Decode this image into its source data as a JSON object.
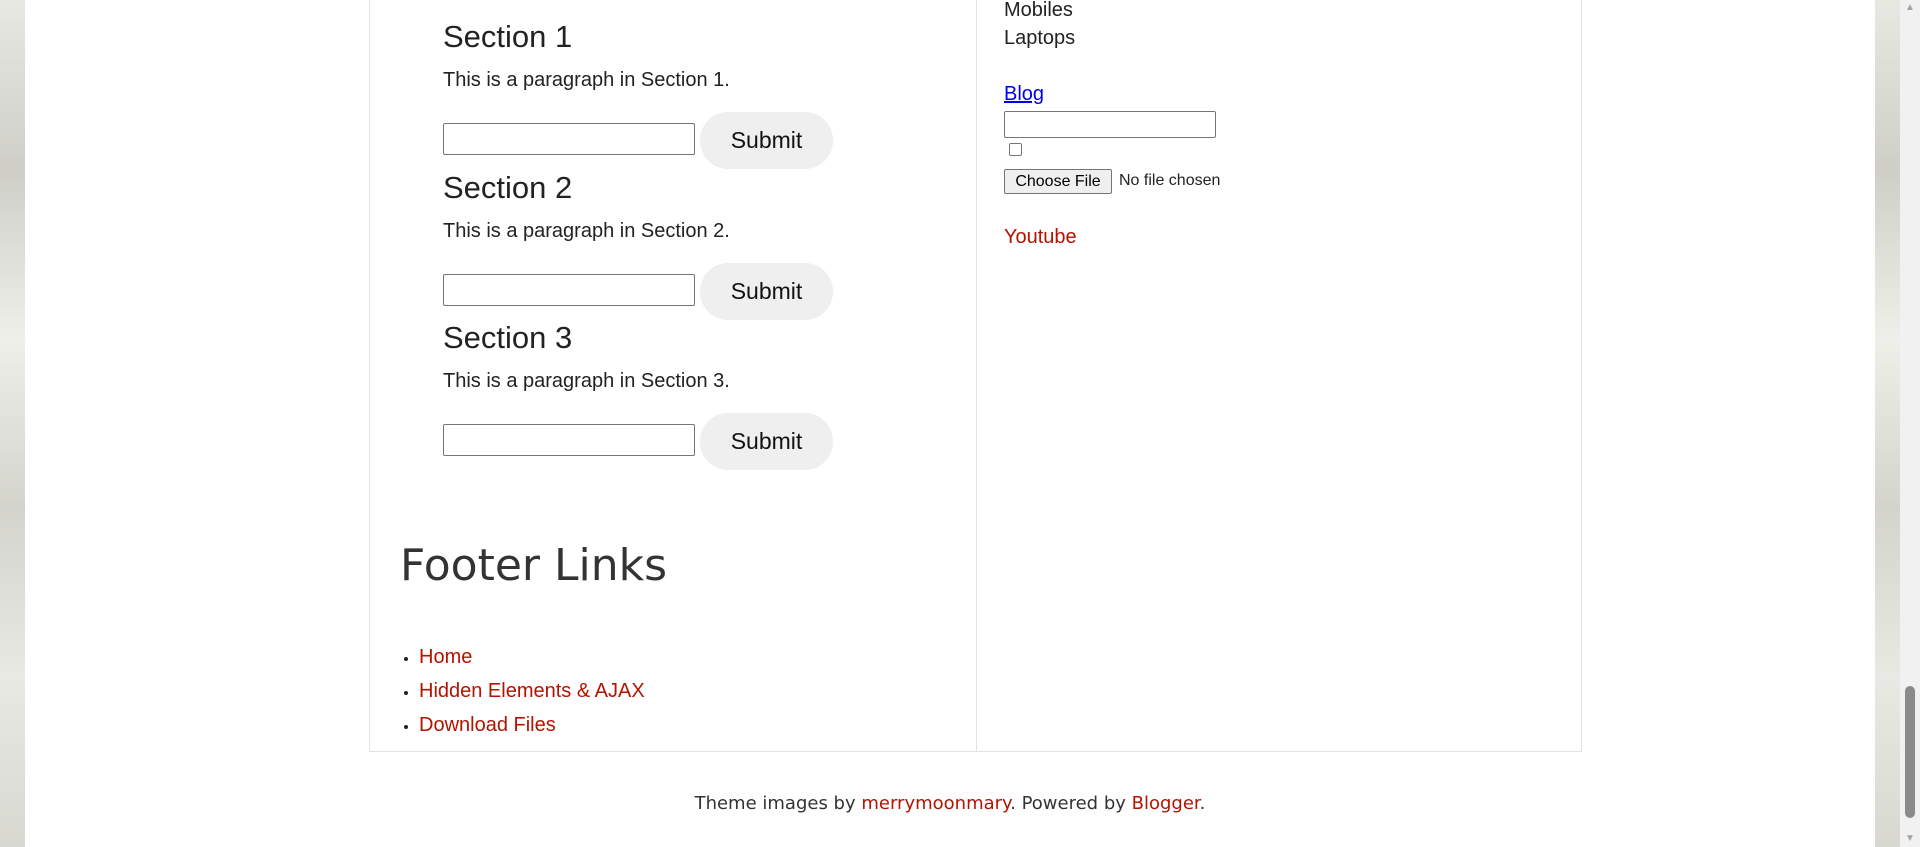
{
  "main": {
    "sections": [
      {
        "title": "Section 1",
        "paragraph": "This is a paragraph in Section 1.",
        "input_value": "",
        "submit_label": "Submit"
      },
      {
        "title": "Section 2",
        "paragraph": "This is a paragraph in Section 2.",
        "input_value": "",
        "submit_label": "Submit"
      },
      {
        "title": "Section 3",
        "paragraph": "This is a paragraph in Section 3.",
        "input_value": "",
        "submit_label": "Submit"
      }
    ],
    "footer_links": {
      "heading": "Footer Links",
      "items": [
        {
          "label": "Home"
        },
        {
          "label": "Hidden Elements & AJAX"
        },
        {
          "label": "Download Files"
        }
      ]
    }
  },
  "sidebar": {
    "list_items": [
      "Mobiles",
      "Laptops"
    ],
    "blog_link": "Blog",
    "text_input_value": "",
    "checkbox_checked": false,
    "file_button": "Choose File",
    "file_status": "No file chosen",
    "youtube_link": "Youtube"
  },
  "credits": {
    "prefix": "Theme images by ",
    "author_link": "merrymoonmary",
    "middle": ". Powered by ",
    "platform_link": "Blogger",
    "suffix": "."
  },
  "colors": {
    "link_red": "#b51200",
    "link_blue": "#0000ee",
    "button_bg": "#efefef"
  },
  "scrollbar": {
    "up_icon": "triangle-up-icon",
    "down_icon": "triangle-down-icon"
  }
}
